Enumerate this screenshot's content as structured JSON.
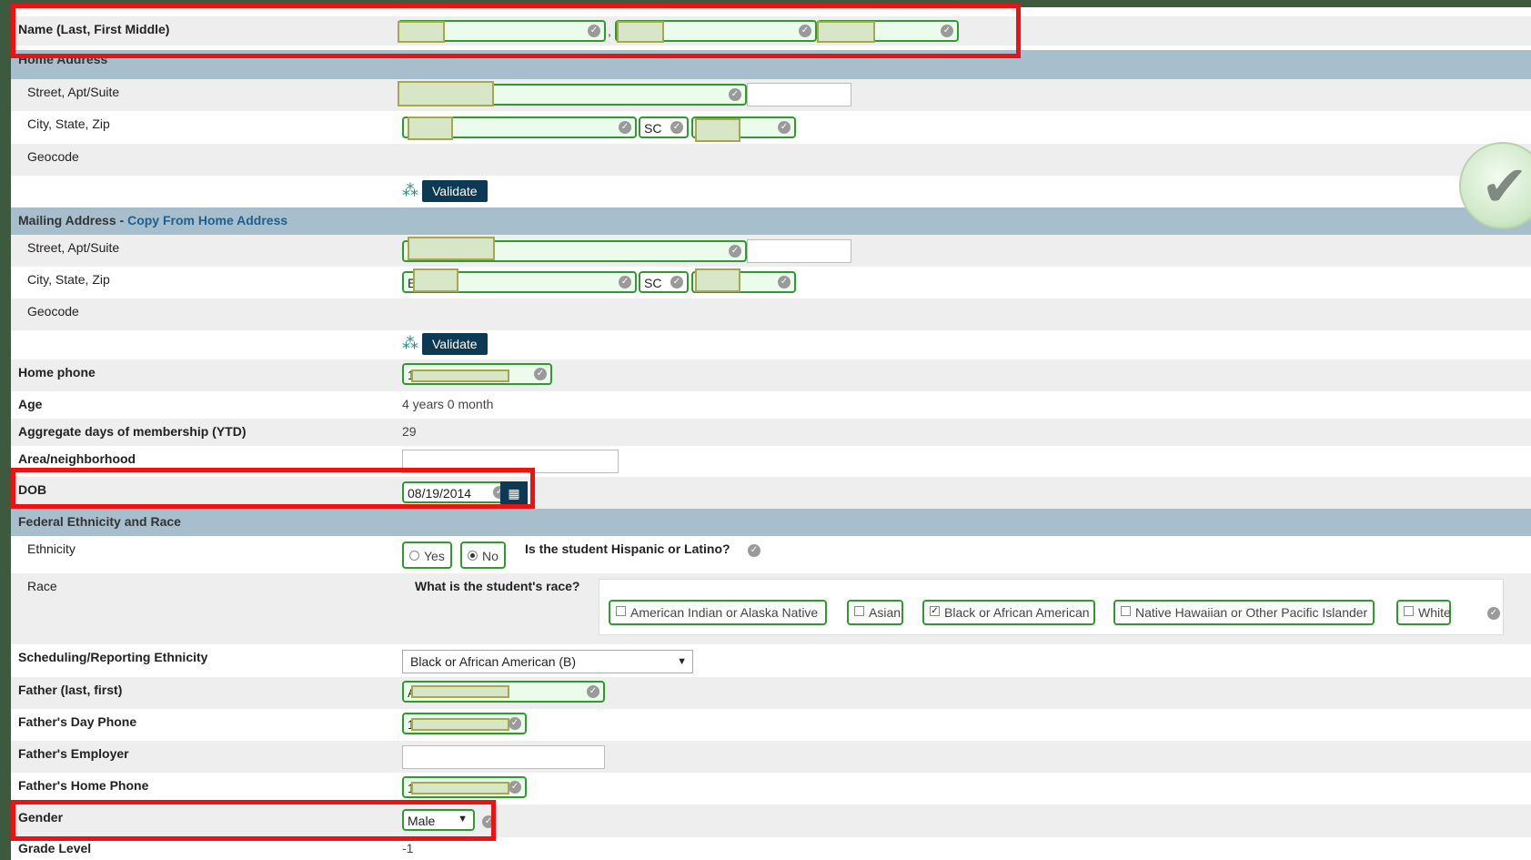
{
  "name_row": {
    "label": "Name  (Last, First Middle)",
    "separator": ","
  },
  "home_address": {
    "section_title": "Home Address",
    "street_label": "Street, Apt/Suite",
    "city_label": "City, State, Zip",
    "state_value": "SC",
    "geocode_label": "Geocode",
    "validate_label": "Validate"
  },
  "mailing_address": {
    "section_title": "Mailing Address",
    "dash": " - ",
    "copy_link": "Copy From Home Address",
    "street_label": "Street, Apt/Suite",
    "city_label": "City, State, Zip",
    "city_partial": "E",
    "state_value": "SC",
    "geocode_label": "Geocode",
    "validate_label": "Validate"
  },
  "home_phone": {
    "label": "Home phone",
    "partial": "1"
  },
  "age": {
    "label": "Age",
    "value": "4 years 0 month"
  },
  "aggregate": {
    "label": "Aggregate days of membership (YTD)",
    "value": "29"
  },
  "area": {
    "label": "Area/neighborhood"
  },
  "dob": {
    "label": "DOB",
    "value": "08/19/2014"
  },
  "ethnicity_section": {
    "title": "Federal Ethnicity and Race"
  },
  "ethnicity": {
    "label": "Ethnicity",
    "yes": "Yes",
    "no": "No",
    "question": "Is the student Hispanic or Latino?"
  },
  "race": {
    "label": "Race",
    "question": "What is the student's race?",
    "options": [
      {
        "label": "American Indian or Alaska Native",
        "checked": false
      },
      {
        "label": "Asian",
        "checked": false
      },
      {
        "label": "Black or African American",
        "checked": true
      },
      {
        "label": "Native Hawaiian or Other Pacific Islander",
        "checked": false
      },
      {
        "label": "White",
        "checked": false
      }
    ]
  },
  "sched_ethnicity": {
    "label": "Scheduling/Reporting Ethnicity",
    "value": "Black or African American (B)"
  },
  "father_name": {
    "label": "Father (last, first)",
    "partial": "A"
  },
  "father_day_phone": {
    "label": "Father's Day Phone",
    "partial": "1"
  },
  "father_employer": {
    "label": "Father's Employer"
  },
  "father_home_phone": {
    "label": "Father's Home Phone",
    "partial": "1"
  },
  "gender": {
    "label": "Gender",
    "value": "Male"
  },
  "grade_level": {
    "label": "Grade Level",
    "value": "-1"
  },
  "icons": {
    "check": "check-circle-icon",
    "validate": "molecule-icon",
    "calendar": "calendar-icon",
    "success": "big-checkmark-icon"
  },
  "colors": {
    "section_bg": "#a7bfcc",
    "input_border": "#2f9a2f",
    "highlight": "#ee1111",
    "button": "#0c3a55"
  }
}
